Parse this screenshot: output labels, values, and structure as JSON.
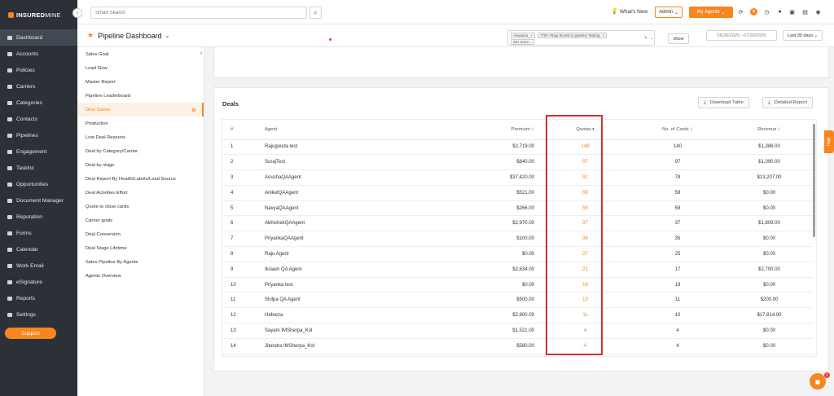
{
  "brand": {
    "part1": "INSURED",
    "part2": "MINE"
  },
  "sidebar": {
    "items": [
      {
        "label": "Dashboard",
        "icon": "dashboard-icon"
      },
      {
        "label": "Accounts",
        "icon": "accounts-icon"
      },
      {
        "label": "Policies",
        "icon": "policies-icon"
      },
      {
        "label": "Carriers",
        "icon": "carriers-icon"
      },
      {
        "label": "Categories",
        "icon": "categories-icon"
      },
      {
        "label": "Contacts",
        "icon": "contacts-icon"
      },
      {
        "label": "Pipelines",
        "icon": "pipelines-icon"
      },
      {
        "label": "Engagement",
        "icon": "engagement-icon"
      },
      {
        "label": "Tasklist",
        "icon": "tasklist-icon"
      },
      {
        "label": "Opportunities",
        "icon": "opportunities-icon"
      },
      {
        "label": "Document Manager",
        "icon": "document-icon"
      },
      {
        "label": "Reputation",
        "icon": "reputation-icon"
      },
      {
        "label": "Forms",
        "icon": "forms-icon"
      },
      {
        "label": "Calendar",
        "icon": "calendar-icon"
      },
      {
        "label": "Work Email",
        "icon": "email-icon"
      },
      {
        "label": "eSignature",
        "icon": "signature-icon"
      },
      {
        "label": "Reports",
        "icon": "reports-icon"
      },
      {
        "label": "Settings",
        "icon": "settings-icon"
      }
    ],
    "support_label": "Support"
  },
  "topbar": {
    "search_placeholder": "Smart Search",
    "whats_new": "What's New",
    "admin_label": "Admin",
    "my_agents_label": "My Agents"
  },
  "page": {
    "title": "Pipeline Dashboard",
    "filter_chips": [
      "Aiswarya",
      "7787--Raju thomls iv pipeline Testing",
      "201 more..."
    ],
    "show_label": "show",
    "date_range": "06/30/2025 - 07/30/2025",
    "period": "Last 30 days"
  },
  "reports": [
    "Sales Goal",
    "Lead Flow",
    "Master Report",
    "Pipeline Leaderboard",
    "Deal Status",
    "Production",
    "Lost Deal Reasons",
    "Deal by Category/Carrier",
    "Deal by stage",
    "Deal Report By Health/Labels/Lead Source",
    "Deal Activities Effort",
    "Quote to close cards",
    "Carrier goals",
    "Deal Conversion",
    "Deal Stage Lifetime",
    "Sales Pipeline By Agents",
    "Agents Overview"
  ],
  "deals": {
    "title": "Deals",
    "download_label": "Download Table",
    "detailed_label": "Detailed Report",
    "columns": {
      "num": "#",
      "agent": "Agent",
      "premium": "Premium",
      "quotes": "Quotes",
      "cards": "No. of Cards",
      "revenue": "Revenue"
    },
    "rows": [
      {
        "num": "1",
        "agent": "Rajugouda test",
        "premium": "$2,719.00",
        "quotes": "148",
        "cards": "140",
        "revenue": "$1,386.00"
      },
      {
        "num": "2",
        "agent": "SurajTest",
        "premium": "$840.00",
        "quotes": "97",
        "cards": "97",
        "revenue": "$1,090.00"
      },
      {
        "num": "3",
        "agent": "AnushaQAAgent",
        "premium": "$37,420.00",
        "quotes": "91",
        "cards": "78",
        "revenue": "$13,207.00"
      },
      {
        "num": "4",
        "agent": "AniketQAAgent",
        "premium": "$521.00",
        "quotes": "59",
        "cards": "58",
        "revenue": "$0.00"
      },
      {
        "num": "5",
        "agent": "NavyaQAAgent",
        "premium": "$266.00",
        "quotes": "58",
        "cards": "58",
        "revenue": "$0.00"
      },
      {
        "num": "6",
        "agent": "AbhishekQAAgent",
        "premium": "$2,970.00",
        "quotes": "37",
        "cards": "37",
        "revenue": "$1,809.00"
      },
      {
        "num": "7",
        "agent": "PriyankaQAAgent",
        "premium": "$100.00",
        "quotes": "36",
        "cards": "35",
        "revenue": "$0.00"
      },
      {
        "num": "8",
        "agent": "Raju Agent",
        "premium": "$0.00",
        "quotes": "27",
        "cards": "25",
        "revenue": "$0.00"
      },
      {
        "num": "9",
        "agent": "Ikraam QA Agent",
        "premium": "$2,634.00",
        "quotes": "21",
        "cards": "17",
        "revenue": "$2,700.00"
      },
      {
        "num": "10",
        "agent": "Priyanka test",
        "premium": "$0.00",
        "quotes": "19",
        "cards": "19",
        "revenue": "$0.00"
      },
      {
        "num": "11",
        "agent": "Shilpa QA Agent",
        "premium": "$500.00",
        "quotes": "13",
        "cards": "11",
        "revenue": "$200.00"
      },
      {
        "num": "12",
        "agent": "Hafeeza",
        "premium": "$2,800.00",
        "quotes": "11",
        "cards": "10",
        "revenue": "$17,814.00"
      },
      {
        "num": "13",
        "agent": "Sayam IMSherpa_Kol",
        "premium": "$1,521.00",
        "quotes": "4",
        "cards": "4",
        "revenue": "$0.00"
      },
      {
        "num": "14",
        "agent": "Jitendra IMSherpa_Kol",
        "premium": "$560.00",
        "quotes": "4",
        "cards": "4",
        "revenue": "$0.00"
      }
    ]
  },
  "help_label": "Help",
  "chat_badge": "1",
  "colors": {
    "accent": "#f7861e",
    "sidebar": "#2b3137",
    "highlight": "#d32f2f"
  }
}
